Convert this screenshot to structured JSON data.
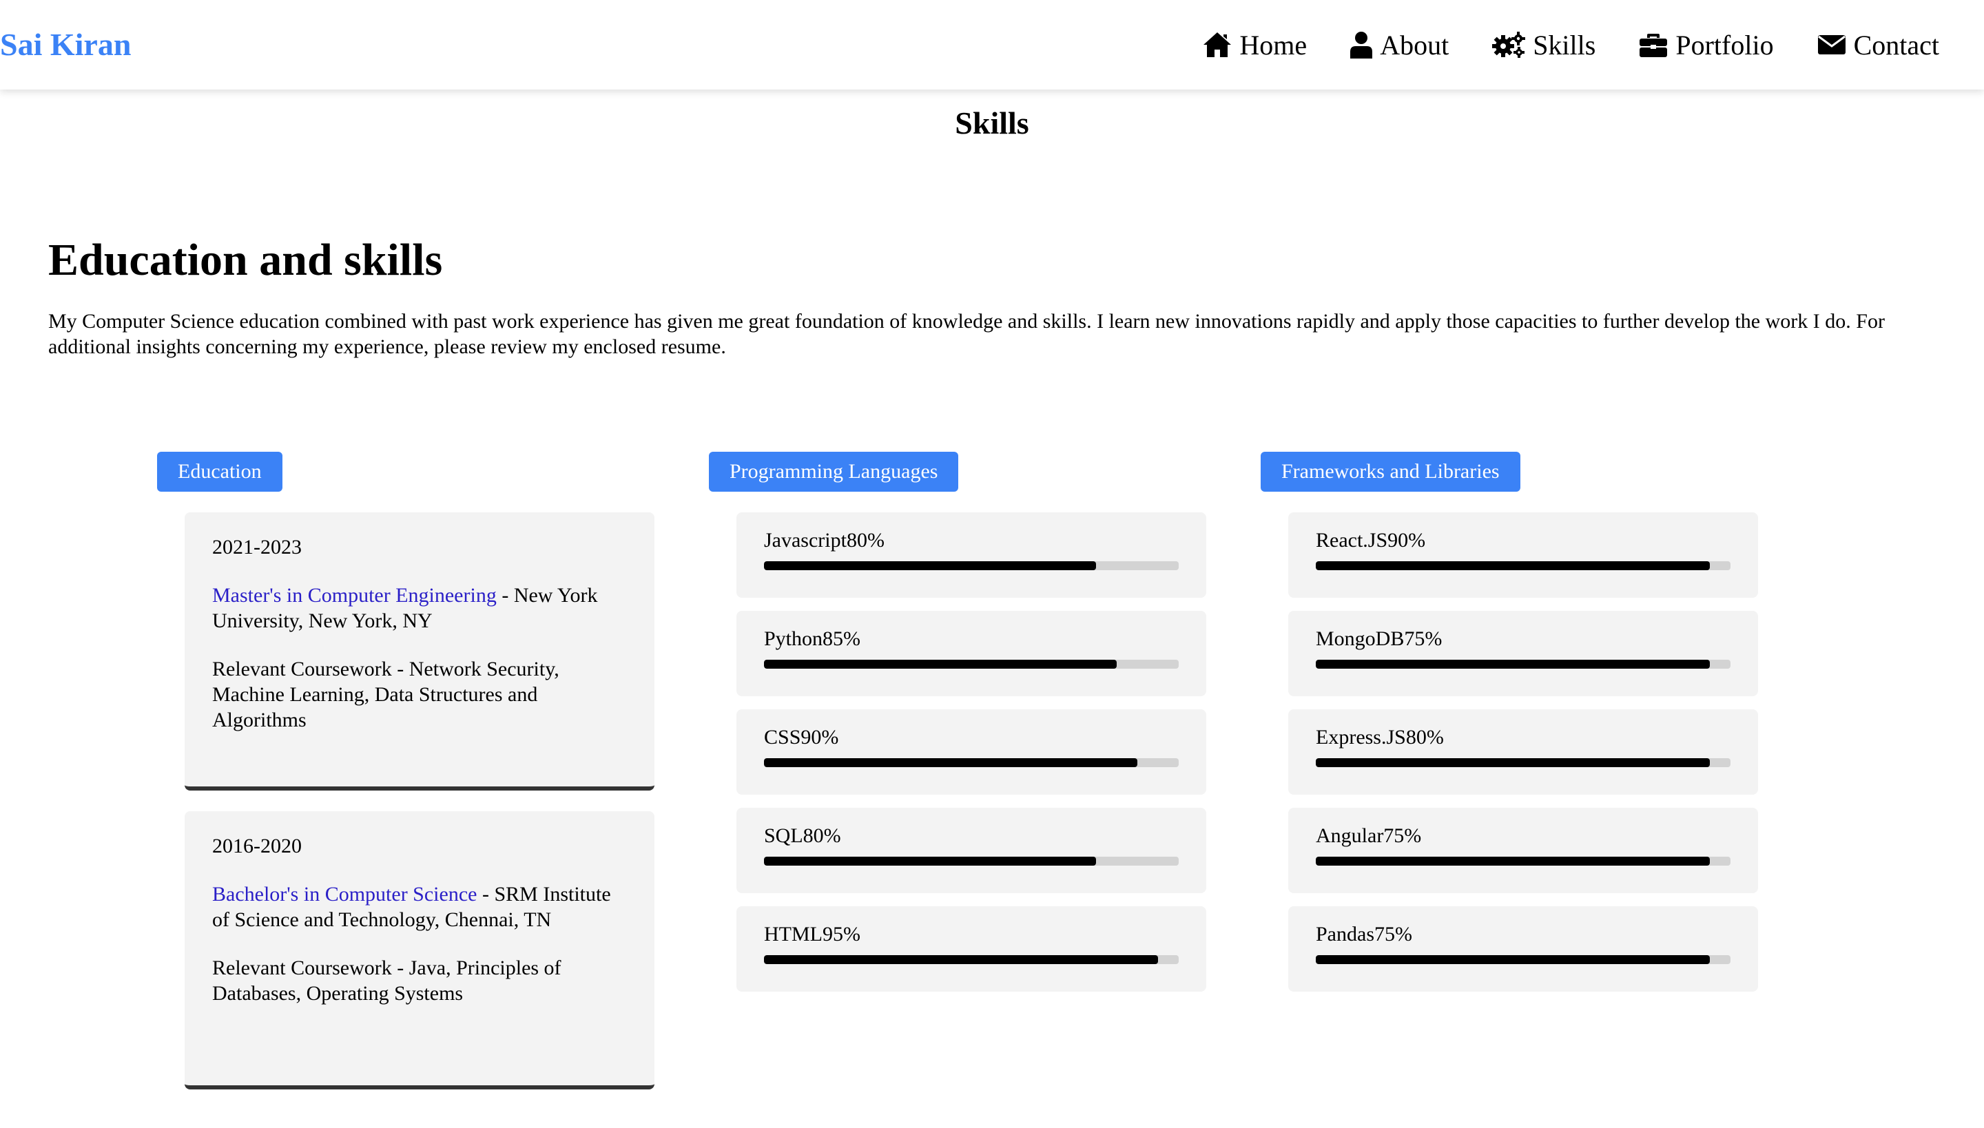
{
  "brand": "Sai Kiran",
  "nav": [
    {
      "label": "Home",
      "icon": "home-icon"
    },
    {
      "label": "About",
      "icon": "user-icon"
    },
    {
      "label": "Skills",
      "icon": "gears-icon"
    },
    {
      "label": "Portfolio",
      "icon": "briefcase-icon"
    },
    {
      "label": "Contact",
      "icon": "envelope-icon"
    }
  ],
  "section_title": "Skills",
  "heading": "Education and skills",
  "intro": "My Computer Science education combined with past work experience has given me great foundation of knowledge and skills. I learn new innovations rapidly and apply those capacities to further develop the work I do. For additional insights concerning my experience, please review my enclosed resume.",
  "colors": {
    "accent": "#3b82f6",
    "degree_link": "#2a1fc7",
    "bar_fill": "#000000",
    "bar_track": "#d3d3d3",
    "card_bg": "#f3f3f3"
  },
  "education": {
    "tag": "Education",
    "items": [
      {
        "years": "2021-2023",
        "degree": "Master's in Computer Engineering",
        "school": " - New York University, New York, NY",
        "coursework": "Relevant Coursework - Network Security, Machine Learning, Data Structures and Algorithms"
      },
      {
        "years": "2016-2020",
        "degree": "Bachelor's in Computer Science",
        "school": " - SRM Institute of Science and Technology, Chennai, TN",
        "coursework": "Relevant Coursework - Java, Principles of Databases, Operating Systems"
      }
    ]
  },
  "programming": {
    "tag": "Programming Languages",
    "items": [
      {
        "label": "Javascript80%",
        "level": 0.8
      },
      {
        "label": "Python85%",
        "level": 0.85
      },
      {
        "label": "CSS90%",
        "level": 0.9
      },
      {
        "label": "SQL80%",
        "level": 0.8
      },
      {
        "label": "HTML95%",
        "level": 0.95
      }
    ]
  },
  "frameworks": {
    "tag": "Frameworks and Libraries",
    "items": [
      {
        "label": "React.JS90%",
        "level": 0.95
      },
      {
        "label": "MongoDB75%",
        "level": 0.95
      },
      {
        "label": "Express.JS80%",
        "level": 0.95
      },
      {
        "label": "Angular75%",
        "level": 0.95
      },
      {
        "label": "Pandas75%",
        "level": 0.95
      }
    ]
  }
}
